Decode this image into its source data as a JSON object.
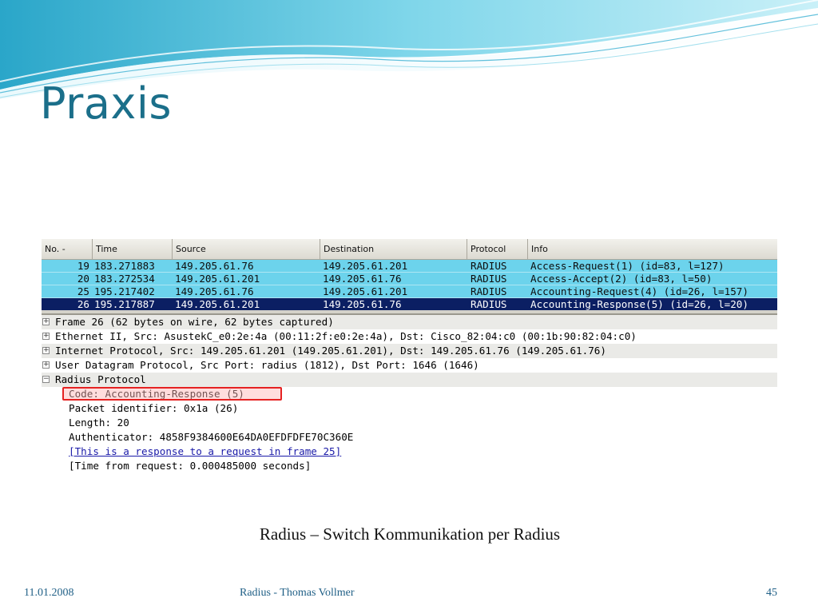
{
  "slide": {
    "title": "Praxis",
    "caption": "Radius – Switch Kommunikation per Radius",
    "footer_date": "11.01.2008",
    "footer_center": "Radius - Thomas Vollmer",
    "page_number": "45",
    "colors": {
      "title": "#1b6f8a",
      "accent_wave": "#5cc4dc",
      "packet_row": "#6cd3ec",
      "selected_row": "#0b1f63",
      "highlight_border": "#e52222"
    }
  },
  "wireshark": {
    "columns": [
      "No. -",
      "Time",
      "Source",
      "Destination",
      "Protocol",
      "Info"
    ],
    "packets": [
      {
        "no": "19",
        "time": "183.271883",
        "source": "149.205.61.76",
        "destination": "149.205.61.201",
        "protocol": "RADIUS",
        "info": "Access-Request(1) (id=83, l=127)"
      },
      {
        "no": "20",
        "time": "183.272534",
        "source": "149.205.61.201",
        "destination": "149.205.61.76",
        "protocol": "RADIUS",
        "info": "Access-Accept(2) (id=83, l=50)"
      },
      {
        "no": "25",
        "time": "195.217402",
        "source": "149.205.61.76",
        "destination": "149.205.61.201",
        "protocol": "RADIUS",
        "info": "Accounting-Request(4) (id=26, l=157)"
      },
      {
        "no": "26",
        "time": "195.217887",
        "source": "149.205.61.201",
        "destination": "149.205.61.76",
        "protocol": "RADIUS",
        "info": "Accounting-Response(5) (id=26, l=20)"
      }
    ],
    "selected_packet_index": 3,
    "details": {
      "nodes": [
        {
          "expander": "+",
          "text": "Frame 26 (62 bytes on wire, 62 bytes captured)"
        },
        {
          "expander": "+",
          "text": "Ethernet II, Src: AsustekC_e0:2e:4a (00:11:2f:e0:2e:4a), Dst: Cisco_82:04:c0 (00:1b:90:82:04:c0)"
        },
        {
          "expander": "+",
          "text": "Internet Protocol, Src: 149.205.61.201 (149.205.61.201), Dst: 149.205.61.76 (149.205.61.76)"
        },
        {
          "expander": "+",
          "text": "User Datagram Protocol, Src Port: radius (1812), Dst Port: 1646 (1646)"
        },
        {
          "expander": "−",
          "text": "Radius Protocol"
        }
      ],
      "radius_fields": [
        "Code: Accounting-Response (5)",
        "Packet identifier: 0x1a (26)",
        "Length: 20",
        "Authenticator: 4858F9384600E64DA0EFDFDFE70C360E",
        "[This is a response to a request in frame 25]",
        "[Time from request: 0.000485000 seconds]"
      ]
    }
  }
}
